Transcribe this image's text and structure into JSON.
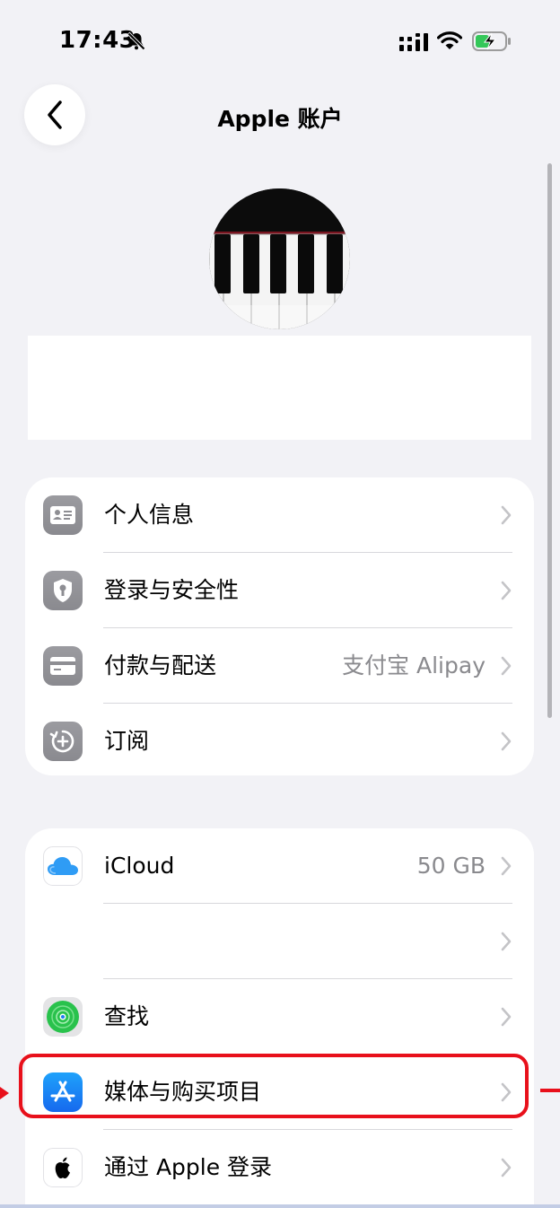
{
  "status_bar": {
    "time": "17:43"
  },
  "nav": {
    "title": "Apple 账户"
  },
  "group1": [
    {
      "label": "个人信息",
      "value": "",
      "icon": "id-card-icon"
    },
    {
      "label": "登录与安全性",
      "value": "",
      "icon": "shield-icon"
    },
    {
      "label": "付款与配送",
      "value": "支付宝 Alipay",
      "icon": "credit-card-icon"
    },
    {
      "label": "订阅",
      "value": "",
      "icon": "subscription-icon"
    }
  ],
  "group2": [
    {
      "label": "iCloud",
      "value": "50 GB",
      "icon": "icloud-icon"
    },
    {
      "label": "",
      "value": "",
      "icon": ""
    },
    {
      "label": "查找",
      "value": "",
      "icon": "find-my-icon"
    },
    {
      "label": "媒体与购买项目",
      "value": "",
      "icon": "app-store-icon"
    },
    {
      "label": "通过 Apple 登录",
      "value": "",
      "icon": "apple-logo-icon"
    }
  ],
  "colors": {
    "highlight": "#e8101b",
    "background": "#f2f2f6",
    "icloud": "#2f9cf5",
    "app_store": "#1b7cf4"
  }
}
